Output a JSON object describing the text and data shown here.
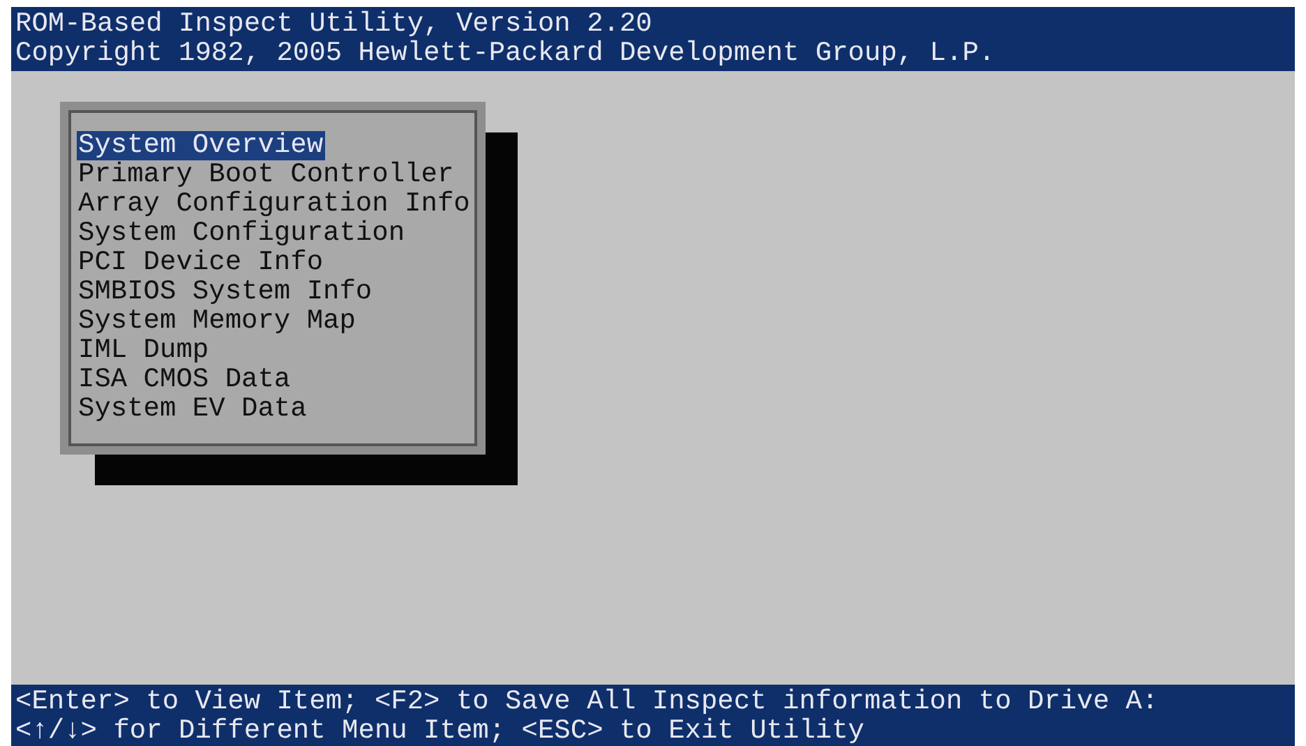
{
  "header": {
    "lines": [
      "ROM-Based Inspect Utility, Version 2.20",
      "Copyright 1982, 2005 Hewlett-Packard Development Group, L.P."
    ]
  },
  "menu": {
    "items": [
      {
        "label": "System Overview",
        "selected": true
      },
      {
        "label": "Primary Boot Controller",
        "selected": false
      },
      {
        "label": "Array Configuration Info",
        "selected": false
      },
      {
        "label": "System Configuration",
        "selected": false
      },
      {
        "label": "PCI Device Info",
        "selected": false
      },
      {
        "label": "SMBIOS System Info",
        "selected": false
      },
      {
        "label": "System Memory Map",
        "selected": false
      },
      {
        "label": "IML Dump",
        "selected": false
      },
      {
        "label": "ISA CMOS Data",
        "selected": false
      },
      {
        "label": "System EV Data",
        "selected": false
      }
    ]
  },
  "footer": {
    "lines": [
      "<Enter> to View Item; <F2> to Save All Inspect information to Drive A:",
      "<↑/↓> for Different Menu Item; <ESC> to Exit Utility"
    ]
  }
}
